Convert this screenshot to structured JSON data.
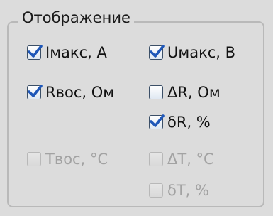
{
  "group": {
    "title": "Отображение"
  },
  "options": {
    "imax": {
      "label": "Iмакс, А",
      "checked": true,
      "enabled": true
    },
    "umax": {
      "label": "Uмакс, В",
      "checked": true,
      "enabled": true
    },
    "rvos": {
      "label": "Rвос, Ом",
      "checked": true,
      "enabled": true
    },
    "delta_r": {
      "label": "ΔR, Ом",
      "checked": false,
      "enabled": true
    },
    "small_delta_r": {
      "label": "δR, %",
      "checked": true,
      "enabled": true
    },
    "tvos": {
      "label": "Tвос, °C",
      "checked": false,
      "enabled": false
    },
    "delta_t": {
      "label": "ΔT, °C",
      "checked": false,
      "enabled": false
    },
    "small_delta_t": {
      "label": "δT, %",
      "checked": false,
      "enabled": false
    }
  },
  "colors": {
    "background": "#dcdcdc",
    "check_mark": "#1f57b8",
    "disabled_text": "#a2a2a2"
  }
}
